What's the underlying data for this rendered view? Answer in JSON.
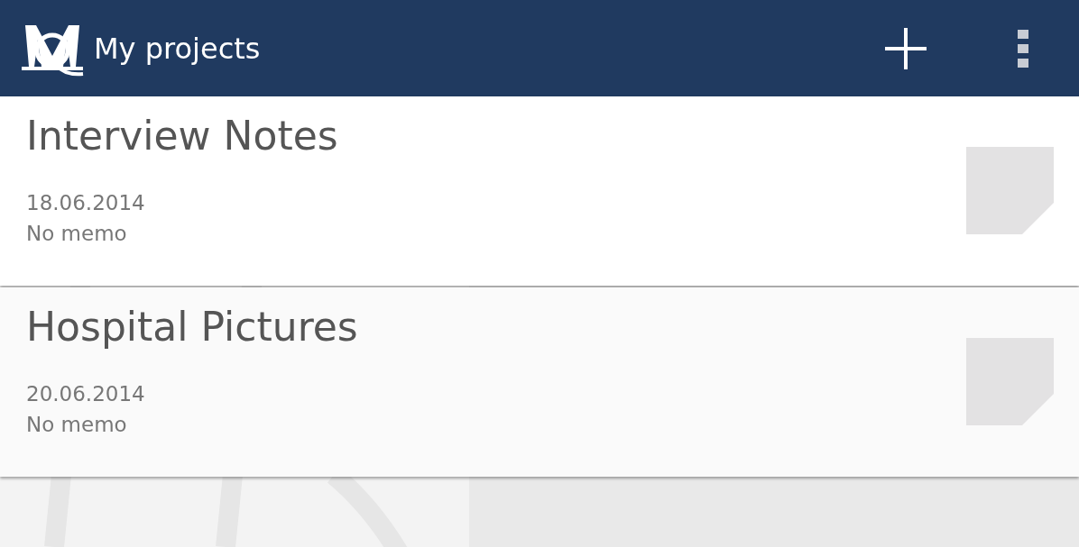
{
  "app_bar": {
    "title": "My projects"
  },
  "projects": [
    {
      "title": "Interview Notes",
      "date": "18.06.2014",
      "memo": "No memo"
    },
    {
      "title": "Hospital Pictures",
      "date": "20.06.2014",
      "memo": "No memo"
    }
  ]
}
